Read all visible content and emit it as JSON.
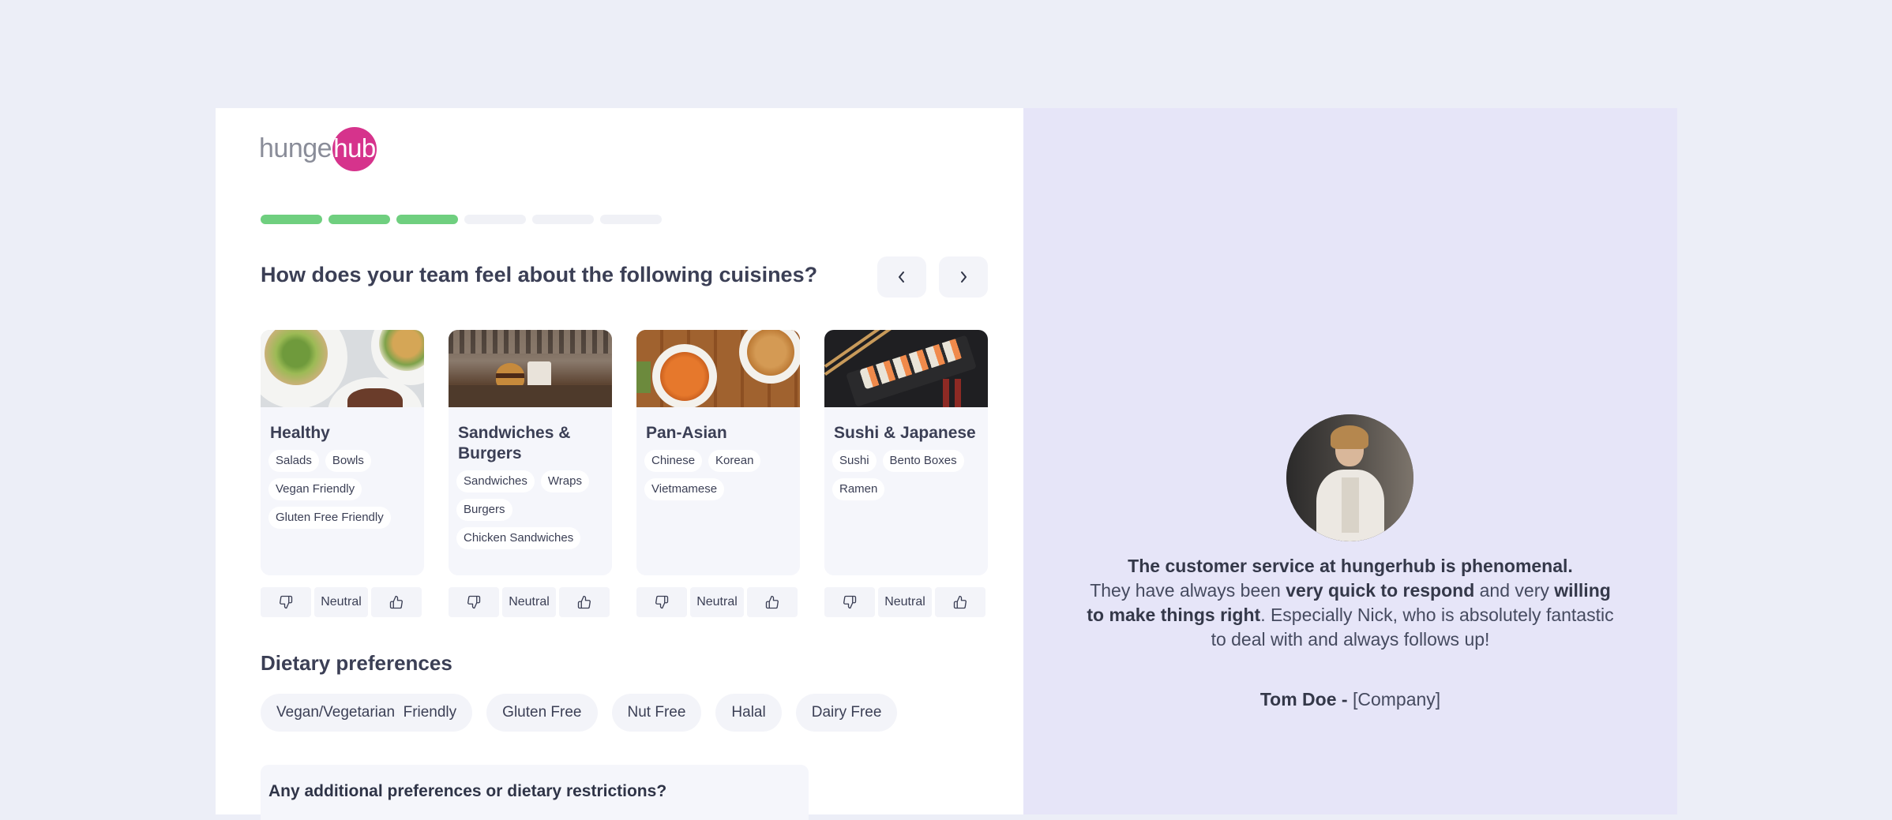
{
  "brand": {
    "logo_left": "hunger",
    "logo_right": "hub",
    "accent": "#d6338c"
  },
  "progress": {
    "total_steps": 6,
    "completed_steps": 3,
    "color_done": "#6fcf7f",
    "color_todo": "#f0f1f6"
  },
  "question": "How does your team feel about the following cuisines?",
  "nav": {
    "prev_icon": "chevron-left-icon",
    "next_icon": "chevron-right-icon"
  },
  "cuisines": [
    {
      "title": "Healthy",
      "tags": [
        "Salads",
        "Bowls",
        "Vegan Friendly",
        "Gluten Free Friendly"
      ],
      "neutral_label": "Neutral"
    },
    {
      "title": "Sandwiches & Burgers",
      "tags": [
        "Sandwiches",
        "Wraps",
        "Burgers",
        "Chicken Sandwiches"
      ],
      "neutral_label": "Neutral"
    },
    {
      "title": "Pan-Asian",
      "tags": [
        "Chinese",
        "Korean",
        "Vietmamese"
      ],
      "neutral_label": "Neutral"
    },
    {
      "title": "Sushi & Japanese",
      "tags": [
        "Sushi",
        "Bento Boxes",
        "Ramen"
      ],
      "neutral_label": "Neutral"
    }
  ],
  "dietary": {
    "title": "Dietary preferences",
    "options": [
      "Vegan/Vegetarian  Friendly",
      "Gluten Free",
      "Nut Free",
      "Halal",
      "Dairy Free"
    ]
  },
  "additional": {
    "label": "Any additional preferences or dietary restrictions?"
  },
  "testimonial": {
    "line1": "The customer service at hungerhub is phenomenal.",
    "part_a": "They have always been ",
    "bold_a": "very quick to respond",
    "part_b": " and very ",
    "bold_b": "willing to make things right",
    "part_c": ".  Especially Nick, who is absolutely fantastic to deal with and always follows up!",
    "author_name": "Tom Doe",
    "author_sep": " - ",
    "author_company": "[Company]"
  }
}
